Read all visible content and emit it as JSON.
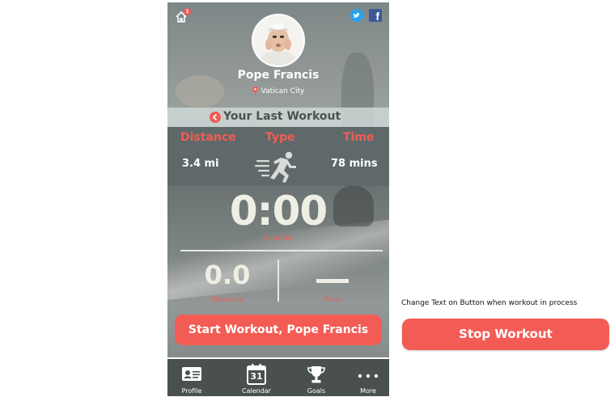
{
  "header": {
    "home_badge": "1",
    "facebook_glyph": "f",
    "icons": [
      "home-icon",
      "twitter-icon",
      "facebook-icon"
    ]
  },
  "profile": {
    "name": "Pope Francis",
    "location": "Vatican City"
  },
  "last_workout": {
    "title": "Your Last Workout",
    "distance_label": "Distance",
    "type_label": "Type",
    "time_label": "Time",
    "distance_value": "3.4 mi",
    "type_icon": "running-icon",
    "time_value": "78 mins"
  },
  "tracker": {
    "timer": "0:00",
    "timer_label": "Duration",
    "distance_value": "0.0",
    "distance_label": "Distance",
    "pace_label": "Pace"
  },
  "actions": {
    "start_label": "Start Workout, Pope Francis"
  },
  "tabs": [
    {
      "label": "Profile",
      "icon": "profile-card-icon"
    },
    {
      "label": "Calendar",
      "icon": "calendar-icon",
      "day": "31"
    },
    {
      "label": "Goals",
      "icon": "trophy-icon"
    },
    {
      "label": "More",
      "icon": "more-dots-icon"
    }
  ],
  "annotation": {
    "note": "Change Text on Button when workout in process",
    "stop_label": "Stop Workout"
  },
  "colors": {
    "accent": "#f25c54",
    "panel": "#5f6969",
    "tabbar": "#4a5050",
    "timer_text": "#eeeee4"
  }
}
